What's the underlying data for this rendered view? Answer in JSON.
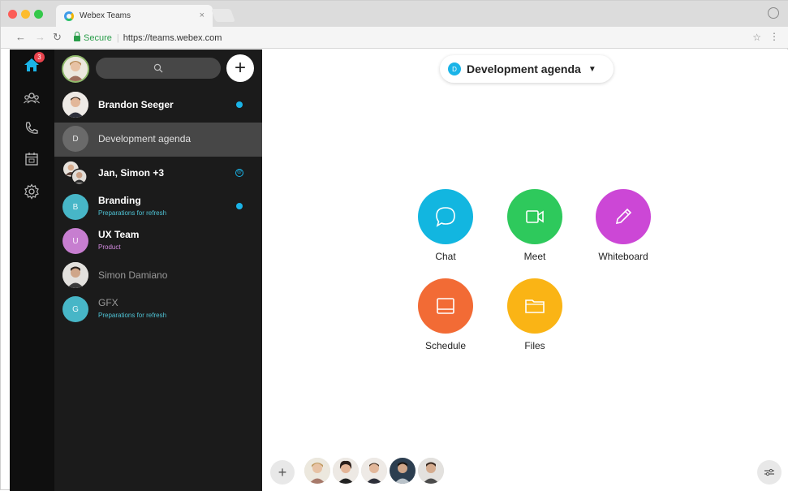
{
  "browser": {
    "tab_title": "Webex Teams",
    "tab_close": "×",
    "secure_label": "Secure",
    "url_scheme": "https://",
    "url_host": "teams.webex.com"
  },
  "rail": {
    "home_badge": "3"
  },
  "sidebar": {
    "add_label": "+",
    "items": [
      {
        "title": "Brandon Seeger",
        "subtitle": "",
        "avatar_type": "person",
        "unread": true
      },
      {
        "title": "Development agenda",
        "subtitle": "",
        "avatar_letter": "D",
        "selected": true
      },
      {
        "title": "Jan, Simon +3",
        "subtitle": "",
        "avatar_type": "group",
        "mention": true
      },
      {
        "title": "Branding",
        "subtitle": "Preparations for refresh",
        "avatar_letter": "B",
        "unread": true
      },
      {
        "title": "UX Team",
        "subtitle": "Product",
        "avatar_letter": "U"
      },
      {
        "title": "Simon Damiano",
        "subtitle": "",
        "avatar_type": "person"
      },
      {
        "title": "GFX",
        "subtitle": "Preparations for refresh",
        "avatar_letter": "G"
      }
    ]
  },
  "main": {
    "space_title": "Development agenda",
    "space_initial": "D",
    "actions": [
      {
        "label": "Chat",
        "color": "#12b6e0",
        "icon": "chat-bubble-icon"
      },
      {
        "label": "Meet",
        "color": "#2ec95c",
        "icon": "video-camera-icon"
      },
      {
        "label": "Whiteboard",
        "color": "#cc47d6",
        "icon": "pencil-icon"
      },
      {
        "label": "Schedule",
        "color": "#f26b35",
        "icon": "calendar-screen-icon"
      },
      {
        "label": "Files",
        "color": "#fab415",
        "icon": "folder-icon"
      }
    ],
    "add_people_label": "+"
  },
  "colors": {
    "rail_bg": "#0f0f0f",
    "sidebar_bg": "#1b1b1b",
    "selected_bg": "#474747",
    "accent": "#1ab4e8",
    "subtitle_teal": "#4fc3d5",
    "subtitle_purple": "#d38be0"
  }
}
